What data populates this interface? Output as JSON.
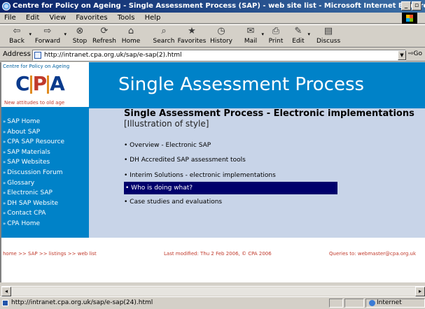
{
  "window": {
    "title": "Centre for Policy on Ageing - Single Assessment Process (SAP) - web site list - Microsoft Internet Explorer",
    "minimize": "_",
    "maximize": "▫",
    "close": "×"
  },
  "menu": [
    "File",
    "Edit",
    "View",
    "Favorites",
    "Tools",
    "Help"
  ],
  "toolbar": [
    {
      "label": "Back",
      "icon": "back-arrow-icon",
      "glyph": "⇦"
    },
    {
      "label": "Forward",
      "icon": "forward-arrow-icon",
      "glyph": "⇨"
    },
    {
      "label": "Stop",
      "icon": "stop-icon",
      "glyph": "⊗"
    },
    {
      "label": "Refresh",
      "icon": "refresh-icon",
      "glyph": "⟳"
    },
    {
      "label": "Home",
      "icon": "home-icon",
      "glyph": "⌂"
    },
    {
      "label": "Search",
      "icon": "search-icon",
      "glyph": "⌕"
    },
    {
      "label": "Favorites",
      "icon": "favorites-icon",
      "glyph": "★"
    },
    {
      "label": "History",
      "icon": "history-icon",
      "glyph": "◷"
    },
    {
      "label": "Mail",
      "icon": "mail-icon",
      "glyph": "✉"
    },
    {
      "label": "Print",
      "icon": "print-icon",
      "glyph": "⎙"
    },
    {
      "label": "Edit",
      "icon": "edit-icon",
      "glyph": "✎"
    },
    {
      "label": "Discuss",
      "icon": "discuss-icon",
      "glyph": "▤"
    }
  ],
  "address": {
    "label": "Address",
    "url": "http://intranet.cpa.org.uk/sap/e-sap(2).html",
    "go": "Go"
  },
  "site": {
    "logo_top": "Centre for Policy on Ageing",
    "logo_c": "C",
    "logo_p": "P",
    "logo_a": "A",
    "logo_sub": "New attitudes to old age",
    "banner": "Single Assessment Process",
    "nav": [
      "SAP Home",
      "About SAP",
      "CPA SAP Resource",
      "SAP Materials",
      "SAP Websites",
      "Discussion Forum",
      "Glossary",
      "Electronic SAP",
      "DH SAP Website",
      "Contact CPA",
      "CPA Home"
    ],
    "heading": "Single Assessment Process - Electronic implementations",
    "subheading": "[Illustration of style]",
    "items": [
      "Overview - Electronic SAP",
      "DH Accredited SAP assessment tools",
      "Interim Solutions - electronic implementations",
      "Who is doing what?",
      "Case studies and evaluations"
    ],
    "selected_item": "Who is doing what?"
  },
  "footer": {
    "breadcrumb": "home >> SAP >> listings >> web list",
    "modified": "Last modified: Thu 2 Feb 2006, © CPA 2006",
    "queries": "Queries to: webmaster@cpa.org.uk"
  },
  "status": {
    "url": "http://intranet.cpa.org.uk/sap/e-sap(24).html",
    "zone": "Internet"
  },
  "colors": {
    "brand_blue": "#0082c8",
    "content_bg": "#c8d4e8",
    "selection": "#00006b",
    "footer_red": "#c0392b"
  }
}
